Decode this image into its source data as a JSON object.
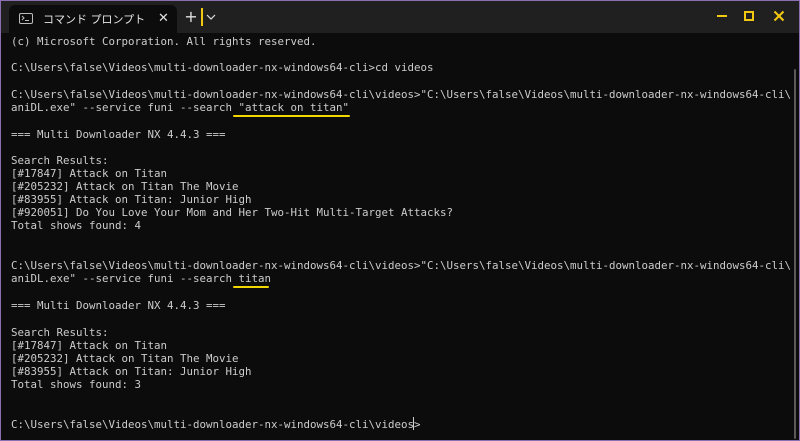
{
  "window": {
    "tab_title": "コマンド プロンプト",
    "tab_close_glyph": "✕",
    "new_tab_glyph": "+",
    "icons": {
      "tab": "terminal-icon",
      "close_tab": "close-icon",
      "new_tab": "plus-icon",
      "dropdown": "chevron-down-icon",
      "minimize": "minimize-icon",
      "maximize": "maximize-icon",
      "close": "close-icon"
    },
    "colors": {
      "titlebar_bg": "#202020",
      "terminal_bg": "#0c0c0c",
      "terminal_text": "#cccccc",
      "caption_buttons": "#f2c811",
      "annotation": "#f2d600",
      "border": "#8a6fb0"
    }
  },
  "terminal": {
    "lines": [
      "(c) Microsoft Corporation. All rights reserved.",
      "",
      "C:\\Users\\false\\Videos\\multi-downloader-nx-windows64-cli>cd videos",
      "",
      "C:\\Users\\false\\Videos\\multi-downloader-nx-windows64-cli\\videos>\"C:\\Users\\false\\Videos\\multi-downloader-nx-windows64-cli\\",
      "aniDL.exe\" --service funi --search \"attack on titan\"",
      "",
      "=== Multi Downloader NX 4.4.3 ===",
      "",
      "Search Results:",
      "[#17847] Attack on Titan",
      "[#205232] Attack on Titan The Movie",
      "[#83955] Attack on Titan: Junior High",
      "[#920051] Do You Love Your Mom and Her Two-Hit Multi-Target Attacks?",
      "Total shows found: 4",
      "",
      "",
      "",
      "C:\\Users\\false\\Videos\\multi-downloader-nx-windows64-cli\\videos>\"C:\\Users\\false\\Videos\\multi-downloader-nx-windows64-cli\\",
      "aniDL.exe\" --service funi --search titan",
      "",
      "=== Multi Downloader NX 4.4.3 ===",
      "",
      "Search Results:",
      "[#17847] Attack on Titan",
      "[#205232] Attack on Titan The Movie",
      "[#83955] Attack on Titan: Junior High",
      "Total shows found: 3",
      "",
      "",
      "C:\\Users\\false\\Videos\\multi-downloader-nx-windows64-cli\\videos>"
    ]
  }
}
